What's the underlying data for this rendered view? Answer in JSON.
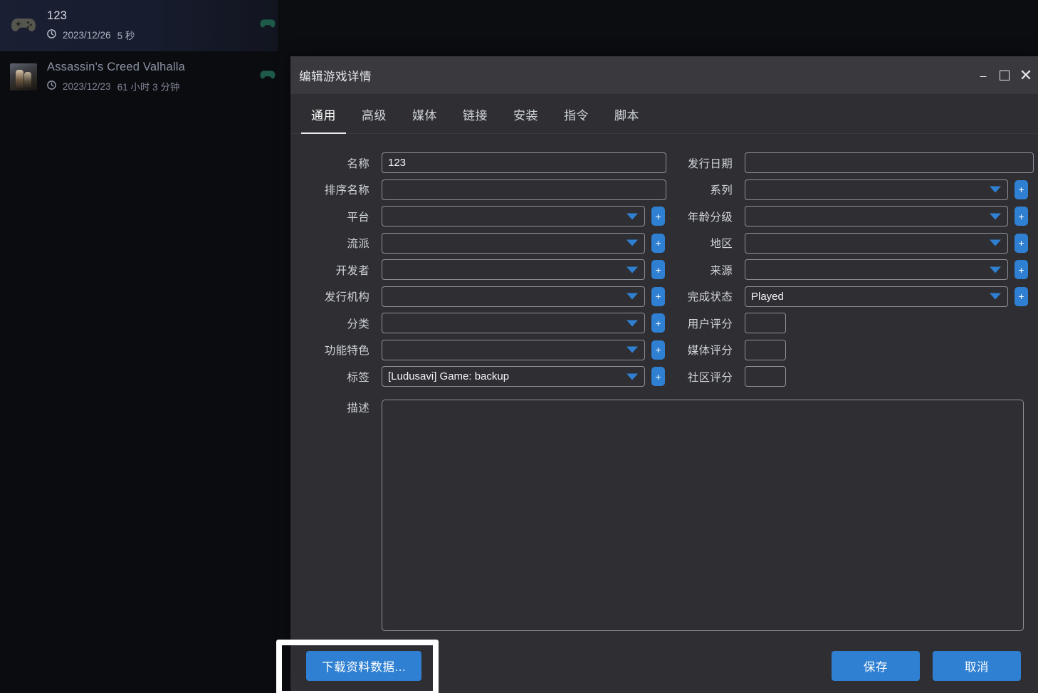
{
  "library": {
    "items": [
      {
        "title": "123",
        "date": "2023/12/26",
        "playtime": "5 秒",
        "icon": "gamepad-icon",
        "selected": true
      },
      {
        "title": "Assassin's Creed Valhalla",
        "date": "2023/12/23",
        "playtime": "61 小时 3 分钟",
        "icon": "game-cover-thumbnail",
        "selected": false
      }
    ]
  },
  "dialog": {
    "title": "编辑游戏详情",
    "window_controls": {
      "minimize": "minimize-icon",
      "maximize": "maximize-icon",
      "close": "close-icon"
    },
    "tabs": [
      {
        "label": "通用",
        "active": true
      },
      {
        "label": "高级",
        "active": false
      },
      {
        "label": "媒体",
        "active": false
      },
      {
        "label": "链接",
        "active": false
      },
      {
        "label": "安装",
        "active": false
      },
      {
        "label": "指令",
        "active": false
      },
      {
        "label": "脚本",
        "active": false
      }
    ],
    "left_fields": [
      {
        "label": "名称",
        "type": "text",
        "value": "123",
        "plus": false
      },
      {
        "label": "排序名称",
        "type": "text",
        "value": "",
        "plus": false
      },
      {
        "label": "平台",
        "type": "combo",
        "value": "",
        "plus": true
      },
      {
        "label": "流派",
        "type": "combo",
        "value": "",
        "plus": true
      },
      {
        "label": "开发者",
        "type": "combo",
        "value": "",
        "plus": true
      },
      {
        "label": "发行机构",
        "type": "combo",
        "value": "",
        "plus": true
      },
      {
        "label": "分类",
        "type": "combo",
        "value": "",
        "plus": true
      },
      {
        "label": "功能特色",
        "type": "combo",
        "value": "",
        "plus": true
      },
      {
        "label": "标签",
        "type": "combo",
        "value": "[Ludusavi] Game: backup",
        "plus": true
      }
    ],
    "right_fields": [
      {
        "label": "发行日期",
        "type": "text",
        "value": "",
        "plus": false
      },
      {
        "label": "系列",
        "type": "combo",
        "value": "",
        "plus": true
      },
      {
        "label": "年龄分级",
        "type": "combo",
        "value": "",
        "plus": true
      },
      {
        "label": "地区",
        "type": "combo",
        "value": "",
        "plus": true
      },
      {
        "label": "来源",
        "type": "combo",
        "value": "",
        "plus": true
      },
      {
        "label": "完成状态",
        "type": "combo",
        "value": "Played",
        "plus": true
      },
      {
        "label": "用户评分",
        "type": "small",
        "value": "",
        "plus": false
      },
      {
        "label": "媒体评分",
        "type": "small",
        "value": "",
        "plus": false
      },
      {
        "label": "社区评分",
        "type": "small",
        "value": "",
        "plus": false
      }
    ],
    "description": {
      "label": "描述",
      "value": ""
    },
    "footer": {
      "download_metadata": "下载资料数据...",
      "save": "保存",
      "cancel": "取消"
    }
  },
  "colors": {
    "accent": "#2f80d2",
    "dialog_bg": "#2f2f33",
    "titlebar_bg": "#3a3a3e",
    "field_border": "#8e9299",
    "focus_frame": "#ffffff"
  }
}
